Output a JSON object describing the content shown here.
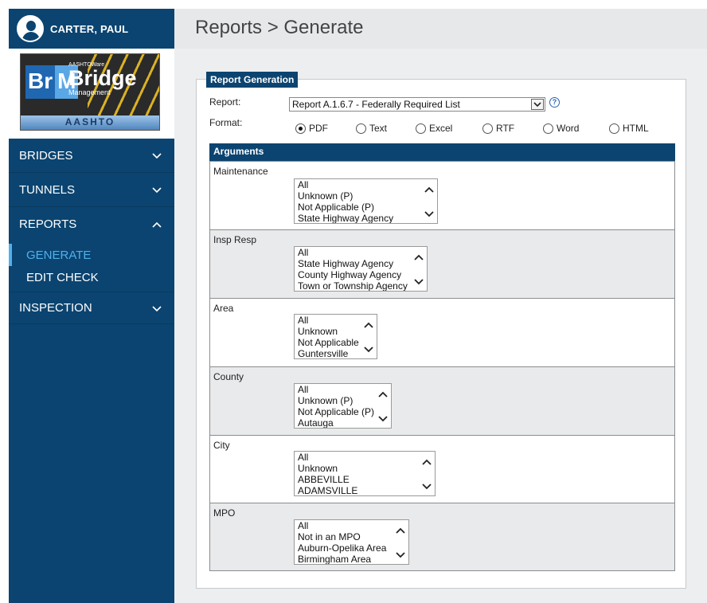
{
  "user": {
    "name": "CARTER, PAUL"
  },
  "logo": {
    "brand_small": "AASHTOWare",
    "brand_big": "Bridge",
    "brand_sub": "Management",
    "brand_br": "Br",
    "brand_m": "M",
    "stripe": "AASHTO"
  },
  "nav": {
    "bridges": "BRIDGES",
    "tunnels": "TUNNELS",
    "reports": "REPORTS",
    "generate": "GENERATE",
    "edit_check": "EDIT CHECK",
    "inspection": "INSPECTION"
  },
  "header": {
    "title": "Reports > Generate"
  },
  "panel": {
    "tab": "Report Generation",
    "report_label": "Report:",
    "report_value": "Report A.1.6.7 - Federally Required List",
    "format_label": "Format:",
    "formats": [
      "PDF",
      "Text",
      "Excel",
      "RTF",
      "Word",
      "HTML"
    ],
    "selected_format": "PDF",
    "arguments_header": "Arguments"
  },
  "arguments": [
    {
      "label": "Maintenance",
      "options": [
        "All",
        "Unknown (P)",
        "Not Applicable (P)",
        "State Highway Agency"
      ]
    },
    {
      "label": "Insp Resp",
      "options": [
        "All",
        "State Highway Agency",
        "County Highway Agency",
        "Town or Township Agency"
      ]
    },
    {
      "label": "Area",
      "options": [
        "All",
        "Unknown",
        "Not Applicable",
        "Guntersville"
      ]
    },
    {
      "label": "County",
      "options": [
        "All",
        "Unknown (P)",
        "Not Applicable (P)",
        "Autauga"
      ]
    },
    {
      "label": "City",
      "options": [
        "All",
        "Unknown",
        "ABBEVILLE",
        "ADAMSVILLE"
      ]
    },
    {
      "label": "MPO",
      "options": [
        "All",
        "Not in an MPO",
        "Auburn-Opelika Area",
        "Birmingham Area"
      ]
    }
  ],
  "icons": {
    "help": "?"
  }
}
